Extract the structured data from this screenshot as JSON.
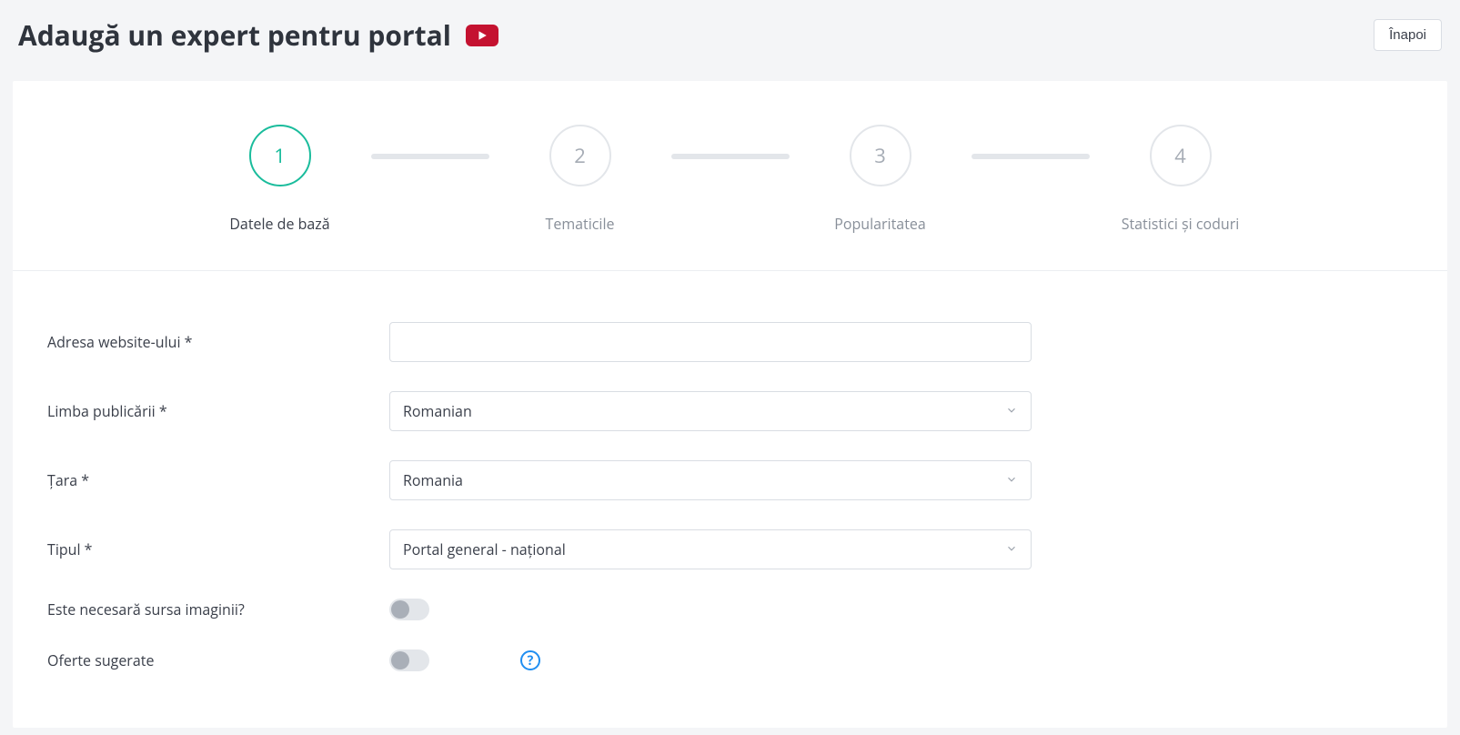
{
  "header": {
    "title": "Adaugă un expert pentru portal",
    "back_label": "Înapoi"
  },
  "stepper": {
    "steps": [
      {
        "num": "1",
        "label": "Datele de bază",
        "active": true
      },
      {
        "num": "2",
        "label": "Tematicile",
        "active": false
      },
      {
        "num": "3",
        "label": "Popularitatea",
        "active": false
      },
      {
        "num": "4",
        "label": "Statistici și coduri",
        "active": false
      }
    ]
  },
  "form": {
    "website": {
      "label": "Adresa website-ului *",
      "value": ""
    },
    "language": {
      "label": "Limba publicării *",
      "value": "Romanian"
    },
    "country": {
      "label": "Țara *",
      "value": "Romania"
    },
    "type": {
      "label": "Tipul *",
      "value": "Portal general - național"
    },
    "image_source": {
      "label": "Este necesară sursa imaginii?",
      "value": false
    },
    "suggested_offers": {
      "label": "Oferte sugerate",
      "value": false,
      "help": "?"
    }
  }
}
